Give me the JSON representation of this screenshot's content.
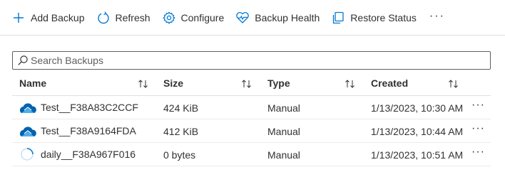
{
  "toolbar": {
    "items": [
      {
        "label": "Add Backup",
        "icon": "plus-icon"
      },
      {
        "label": "Refresh",
        "icon": "refresh-icon"
      },
      {
        "label": "Configure",
        "icon": "gear-icon"
      },
      {
        "label": "Backup Health",
        "icon": "heart-pulse-icon"
      },
      {
        "label": "Restore Status",
        "icon": "copy-icon"
      }
    ],
    "more_label": "···"
  },
  "search": {
    "placeholder": "Search Backups",
    "value": ""
  },
  "table": {
    "columns": [
      {
        "label": "Name"
      },
      {
        "label": "Size"
      },
      {
        "label": "Type"
      },
      {
        "label": "Created"
      }
    ],
    "rows": [
      {
        "name": "Test__F38A83C2CCF",
        "size": "424 KiB",
        "type": "Manual",
        "created": "1/13/2023, 10:30 AM",
        "icon": "cloud-backup-icon",
        "more": "···"
      },
      {
        "name": "Test__F38A9164FDA",
        "size": "412 KiB",
        "type": "Manual",
        "created": "1/13/2023, 10:44 AM",
        "icon": "cloud-backup-icon",
        "more": "···"
      },
      {
        "name": "daily__F38A967F016",
        "size": "0 bytes",
        "type": "Manual",
        "created": "1/13/2023, 10:51 AM",
        "icon": "progress-ring-icon",
        "more": "···"
      }
    ]
  },
  "colors": {
    "accent": "#0078d4",
    "cloud_dark": "#0063b1",
    "cloud_light": "#50b0e8",
    "border": "#e1dfdd",
    "text": "#323130"
  }
}
